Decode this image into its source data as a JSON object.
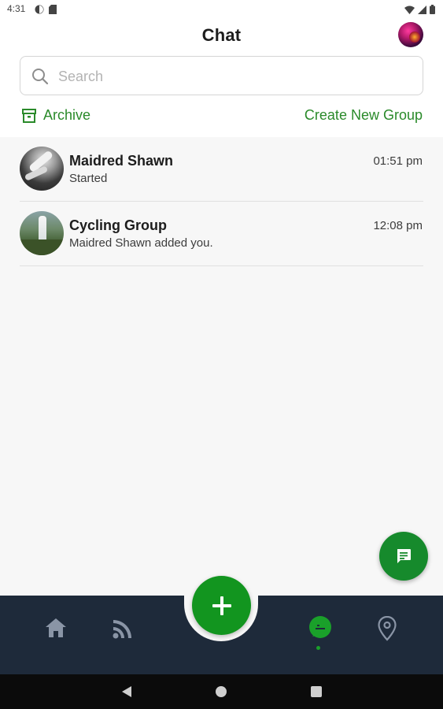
{
  "status_bar": {
    "time": "4:31"
  },
  "header": {
    "title": "Chat"
  },
  "search": {
    "placeholder": "Search",
    "value": ""
  },
  "actions": {
    "archive_label": "Archive",
    "create_group_label": "Create New Group"
  },
  "chats": [
    {
      "name": "Maidred Shawn",
      "preview": "Started",
      "time": "01:51 pm"
    },
    {
      "name": "Cycling Group",
      "preview": "Maidred Shawn added you.",
      "time": "12:08 pm"
    }
  ],
  "bottom_nav": {
    "items": [
      "home-icon",
      "feed-icon",
      "chat-icon",
      "location-pin-icon"
    ],
    "active": "chat-icon"
  },
  "colors": {
    "accent": "#168a2c",
    "nav_bg": "#1e2a3a",
    "list_bg": "#f7f7f7"
  }
}
